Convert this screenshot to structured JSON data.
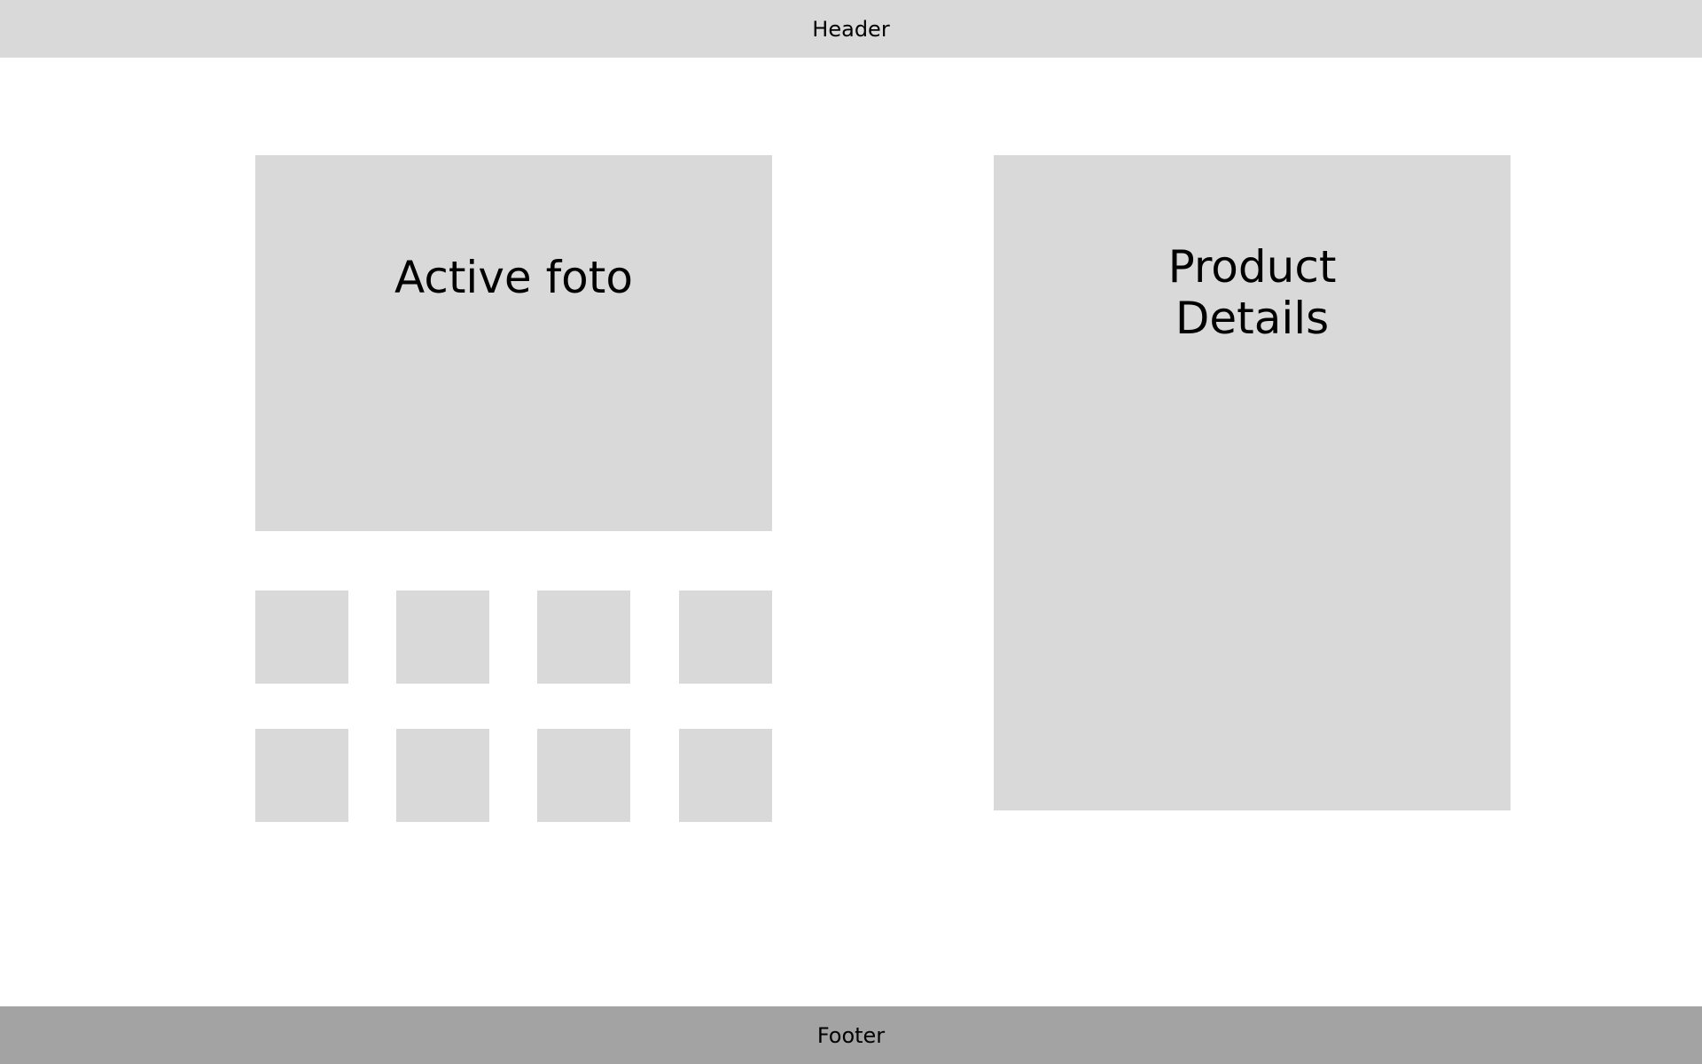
{
  "header": {
    "label": "Header"
  },
  "gallery": {
    "active_photo_label": "Active foto",
    "thumbnails_count_shown": 8
  },
  "details": {
    "label_line1": "Product",
    "label_line2": "Details"
  },
  "footer": {
    "label": "Footer"
  },
  "colors": {
    "placeholder": "#d9d9d9",
    "footer": "#a3a3a3",
    "background": "#ffffff",
    "text": "#000000"
  }
}
